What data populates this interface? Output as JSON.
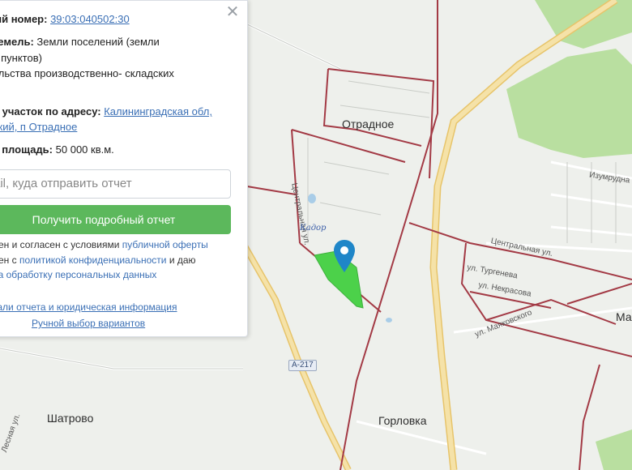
{
  "panel": {
    "close_icon": "close-icon",
    "cadastral_label": "ый номер:",
    "cadastral_number": "39:03:040502:30",
    "land_category_label": "земель:",
    "land_category_value_1": "Земли поселений (земли",
    "land_category_value_2": "х пунктов)",
    "permitted_use": "ельства производственно- складских",
    "address_label": "й участок по адресу:",
    "address_link_1": "Калининградская обл,",
    "address_link_2": "ский, п Отрадное",
    "area_label": "я площадь:",
    "area_value": "50 000 кв.м.",
    "email_placeholder": "ail, куда отправить отчет",
    "report_button": "Получить подробный отчет",
    "consent_line1_text": "лен и согласен с условиями",
    "consent_line1_link": "публичной оферты",
    "consent_line2_text": "лен с",
    "consent_line2_link": "политикой конфиденциальности",
    "consent_line2_tail": "и даю",
    "consent_line3_link": "на обработку персональных данных",
    "details_link": "тали отчета и юридическая информация",
    "manual_link": "Ручной выбор вариантов"
  },
  "map": {
    "places": {
      "otradnoe": "Отрадное",
      "shatrovo": "Шатрово",
      "gorlovka": "Горловка",
      "ma": "Ма"
    },
    "streets": {
      "centralnaya_vertical": "Центральная ул.",
      "centralnaya_right": "Центральная ул.",
      "turgeneva": "ул. Тургенева",
      "nekrasova": "ул. Некрасова",
      "mayakovskogo": "ул. Маяковского",
      "izumrudnaya": "Изумрудна",
      "lesnaya": "Лесная ул."
    },
    "road_badge": "А-217",
    "company_logo": "Кадор",
    "marker_icon": "location-pin-icon",
    "colors": {
      "boundary": "#a33a45",
      "highway": "#f1d27a",
      "forest": "#b9dfa0",
      "plot": "#4cd14a",
      "marker": "#1f86c8"
    }
  }
}
